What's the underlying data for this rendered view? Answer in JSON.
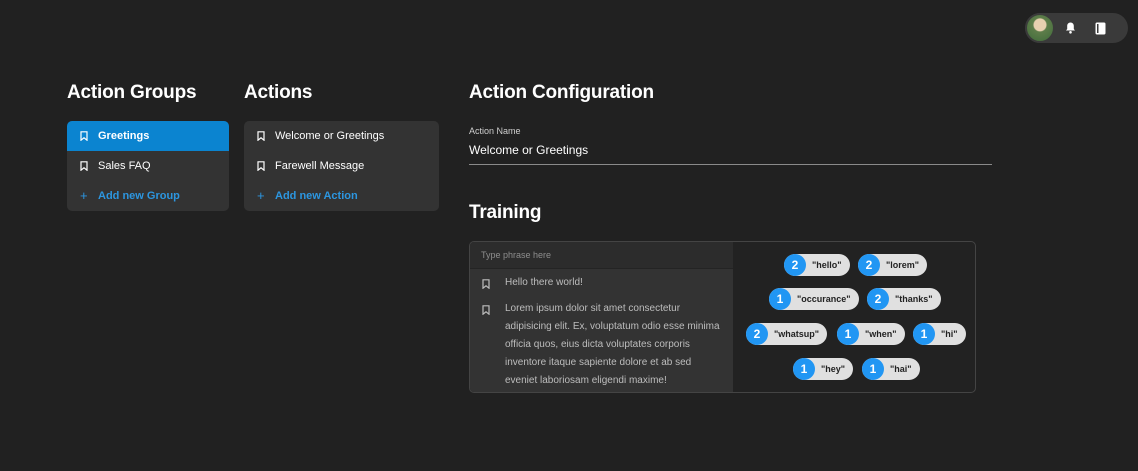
{
  "topbar": {
    "avatar_icon": "user-avatar",
    "bell_icon": "bell-icon",
    "book_icon": "book-icon"
  },
  "groups": {
    "title": "Action Groups",
    "items": [
      {
        "label": "Greetings",
        "icon": "bookmark-icon",
        "active": true
      },
      {
        "label": "Sales FAQ",
        "icon": "bookmark-icon",
        "active": false
      }
    ],
    "add_label": "Add new Group"
  },
  "actions": {
    "title": "Actions",
    "items": [
      {
        "label": "Welcome or Greetings",
        "icon": "bookmark-icon"
      },
      {
        "label": "Farewell Message",
        "icon": "bookmark-icon"
      }
    ],
    "add_label": "Add new Action"
  },
  "config": {
    "title": "Action Configuration",
    "name_label": "Action Name",
    "name_value": "Welcome or Greetings"
  },
  "training": {
    "title": "Training",
    "placeholder": "Type phrase here",
    "phrases": [
      "Hello there world!",
      "Lorem ipsum dolor sit amet consectetur adipisicing elit. Ex, voluptatum odio esse minima officia quos, eius dicta voluptates corporis inventore itaque sapiente dolore et ab sed eveniet laboriosam eligendi maxime!"
    ],
    "chips": [
      {
        "count": "2",
        "word": "\"hello\""
      },
      {
        "count": "2",
        "word": "\"lorem\""
      },
      {
        "count": "1",
        "word": "\"occurance\""
      },
      {
        "count": "2",
        "word": "\"thanks\""
      },
      {
        "count": "2",
        "word": "\"whatsup\""
      },
      {
        "count": "1",
        "word": "\"when\""
      },
      {
        "count": "1",
        "word": "\"hi\""
      },
      {
        "count": "1",
        "word": "\"hey\""
      },
      {
        "count": "1",
        "word": "\"hai\""
      }
    ]
  },
  "colors": {
    "background": "#212121",
    "panel": "#333333",
    "accent": "#0b84d0",
    "chip_count": "#2196f3",
    "chip_bg": "#e0e0e0"
  }
}
